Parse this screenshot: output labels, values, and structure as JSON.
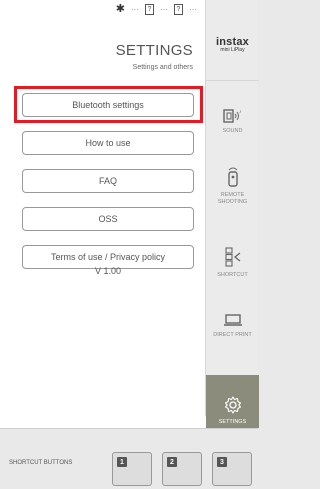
{
  "status": {
    "card1": "?",
    "card2": "?",
    "dots": "···"
  },
  "header": {
    "title": "SETTINGS",
    "subtitle": "Settings and others"
  },
  "menu": [
    {
      "label": "Bluetooth settings"
    },
    {
      "label": "How to use"
    },
    {
      "label": "FAQ"
    },
    {
      "label": "OSS"
    },
    {
      "label": "Terms of use / Privacy policy"
    }
  ],
  "version": "V 1.00",
  "sidebar": {
    "logo_line1": "instax",
    "logo_line2": "mini LiPlay",
    "items": [
      {
        "label": "SOUND",
        "icon": "sound-icon"
      },
      {
        "label": "REMOTE SHOOTING",
        "icon": "remote-shooting-icon"
      },
      {
        "label": "SHORTCUT",
        "icon": "shortcut-icon"
      },
      {
        "label": "DIRECT PRINT",
        "icon": "direct-print-icon"
      },
      {
        "label": "SETTINGS",
        "icon": "gear-icon"
      }
    ]
  },
  "shortcuts": {
    "label": "SHORTCUT BUTTONS",
    "buttons": [
      "1",
      "2",
      "3"
    ]
  },
  "colors": {
    "highlight": "#e41b23",
    "active_nav": "#8c8c7c"
  }
}
